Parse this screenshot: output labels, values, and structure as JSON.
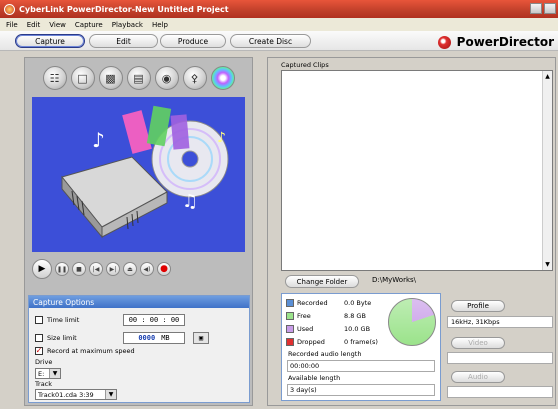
{
  "window": {
    "title": "CyberLink PowerDirector-New Untitled Project"
  },
  "menu": [
    "File",
    "Edit",
    "View",
    "Capture",
    "Playback",
    "Help"
  ],
  "modes": [
    {
      "label": "Capture",
      "active": true
    },
    {
      "label": "Edit",
      "active": false
    },
    {
      "label": "Produce",
      "active": false
    },
    {
      "label": "Create Disc",
      "active": false
    }
  ],
  "brand": {
    "name": "PowerDirector"
  },
  "capture_sources": [
    "tv-tuner-icon",
    "scanner-icon",
    "monitor-icon",
    "dvd-drive-icon",
    "microphone-icon",
    "mic-stand-icon",
    "cd-icon"
  ],
  "capture_options": {
    "title": "Capture Options",
    "time_limit": {
      "label": "Time limit",
      "value": "00 : 00 : 00",
      "checked": false
    },
    "size_limit": {
      "label": "Size limit",
      "value": "0000",
      "unit": "MB",
      "checked": false
    },
    "record_max": {
      "label": "Record at maximum speed",
      "checked": true
    },
    "drive_label": "Drive",
    "drive_value": "E:",
    "track_label": "Track",
    "track_value": "Track01.cda  3:39"
  },
  "clips": {
    "label": "Captured Clips"
  },
  "folder": {
    "button": "Change Folder",
    "path": "D:\\MyWorks\\"
  },
  "storage": {
    "recorded": {
      "label": "Recorded",
      "value": "0.0 Byte",
      "color": "#5a8fd6"
    },
    "free": {
      "label": "Free",
      "value": "8.8 GB",
      "color": "#9be38b"
    },
    "used": {
      "label": "Used",
      "value": "10.0 GB",
      "color": "#c89ce8"
    },
    "dropped": {
      "label": "Dropped",
      "value": "0 frame(s)",
      "color": "#e03030"
    },
    "recorded_audio_label": "Recorded audio length",
    "recorded_audio_value": "00:00:00",
    "available_label": "Available length",
    "available_value": "3 day(s)"
  },
  "profile": {
    "button": "Profile",
    "value": "16kHz,  31Kbps",
    "video_button": "Video",
    "audio_button": "Audio"
  }
}
